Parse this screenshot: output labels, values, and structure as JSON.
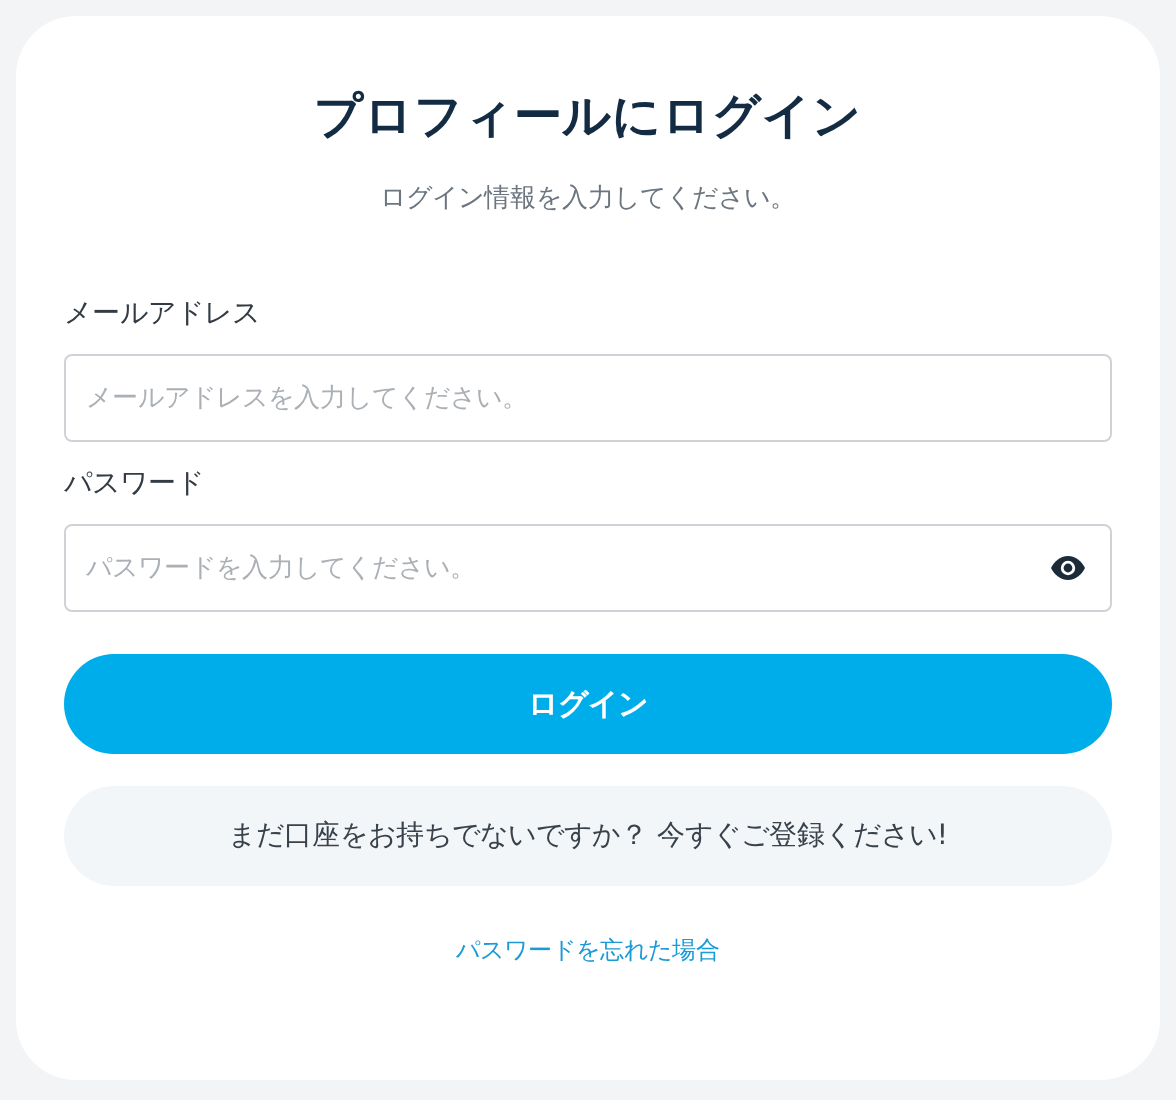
{
  "title": "プロフィールにログイン",
  "subtitle": "ログイン情報を入力してください。",
  "fields": [
    {
      "label": "メールアドレス",
      "placeholder": "メールアドレスを入力してください。",
      "kind": "email"
    },
    {
      "label": "パスワード",
      "placeholder": "パスワードを入力してください。",
      "kind": "password"
    }
  ],
  "login_button": "ログイン",
  "signup_prompt": "まだ口座をお持ちでないですか？ 今すぐご登録ください!",
  "forgot_link": "パスワードを忘れた場合"
}
